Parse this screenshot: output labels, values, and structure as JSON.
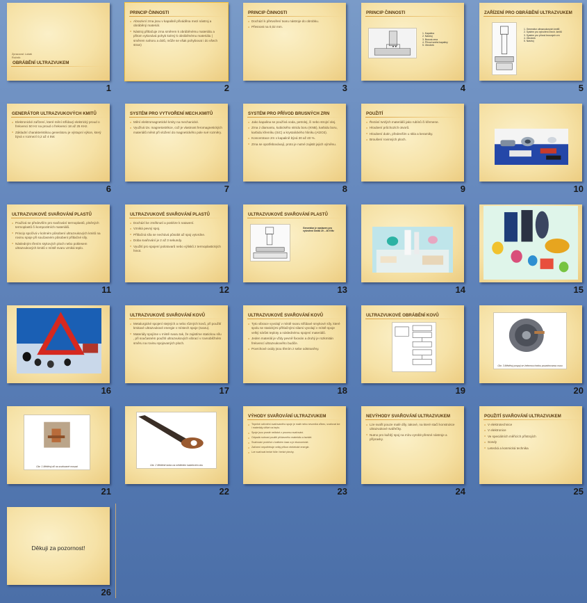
{
  "slides": [
    {
      "num": "1",
      "type": "title",
      "subtitle": [
        "Zpracoval: Lukáš",
        "Ročník:"
      ],
      "title": "OBRÁBĚNÍ ULTRAZVUKEM"
    },
    {
      "num": "2",
      "type": "text",
      "title": "PRINCIP ČINNOSTI",
      "bullets": [
        "Abrazivní zrna jsou v kapalině přiváděna  mezi nástroj a obráběný materiál.",
        "Nástroj přitlačuje zrna směrem k obráběnému materiálu a přitom vykonává pohyb kolmý k obráběnému materiálu  ( směrem nahoru a dolů,  může se však pohybovat i do všech stran)"
      ]
    },
    {
      "num": "3",
      "type": "text",
      "title": "PRINCIP ČINNOSTI",
      "bullets": [
        "Dochází k přetvoření tvaru nástroje do obrobku.",
        "Přesnost na 0,02 mm."
      ]
    },
    {
      "num": "4",
      "type": "diagram",
      "title": "PRINCIP ČINNOSTI",
      "legend": [
        "1. Kapalina",
        "2. Nástroj",
        "3. Brusná zrna",
        "4. Přívod směsi kapaliny",
        "5. Obrobek"
      ]
    },
    {
      "num": "5",
      "type": "diagram2",
      "title": "ZAŘÍZENÍ PRO OBRÁBĚNÍ ULTRAZVUKEM",
      "legend": [
        "1. Generátor ultrazvukových kmitů",
        "2. Systém pro vytvoření mech. kmitů",
        "3. Systém pro přívod brusných zrn",
        "4. Obrobek",
        "5. Nástroj"
      ]
    },
    {
      "num": "6",
      "type": "text",
      "title": "GENERÁTOR ULTRAZVUKOVÝCH KMITŮ",
      "bullets": [
        "Elektronické zařízení, které mění střídavý elektrický proud o frekvenci 50 Hz na proud o frekvenci 18 až 25 KHz.",
        "Základní charakteristikou generátoru je výstupní výkon, který bývá v rozmezí 0,2 až 4 kW."
      ]
    },
    {
      "num": "7",
      "type": "text",
      "title": "SYSTÉM PRO VYTVOŘENÍ MECH.KMITŮ",
      "bullets": [
        "Mění elektromagnetické kmity na mechanické.",
        "Využívá tzv. magnetostrikce, což je vlastnost feromagnetických materiálů měnit při vložení do magnetického pole své rozměry."
      ]
    },
    {
      "num": "8",
      "type": "text",
      "title": "SYSTÉM PRO PŘÍVOD BRUSNÝCH ZRN",
      "bullets": [
        "Jako kapalina se používá voda, petrolej, či nebo strojní olej.",
        "Zrna z diamantu, kubického nitridu boru (KNB), karbidu boru, karbidu křemíku (SiC) a krystalického hliníku  (Al2O3).",
        "Koncentrace zrn v kapalině bývá 30 až 40 %.",
        "Zrna se opotřebovávají, proto je nutné zajistit jejich výměnu."
      ]
    },
    {
      "num": "9",
      "type": "text",
      "title": "POUŽITÍ",
      "bullets": [
        "Řezání tvrdých materiálů jako rubínů či křemene.",
        "Hloubení průchozích otvorů.",
        "Hloubení dutin, především u skla a keramiky.",
        "Broušení rovinných ploch."
      ]
    },
    {
      "num": "10",
      "type": "photo",
      "scene": "parts-blue"
    },
    {
      "num": "11",
      "type": "text",
      "title": "ULTRAZVUKOVÉ SVAŘOVÁNÍ PLASTŮ",
      "bullets": [
        "Použivá se především pro svařování termoplastů, plněných termoplastů či kompozitních materiálů.",
        "Princip spočívá v kolmém působení ultrazvukových kmitů na rovinu spoje při současném působení přítlačné síly.",
        "Následným třením stykových ploch nebo poklesem ultrazvukových kmitů v místě svaru vzniká teplo."
      ]
    },
    {
      "num": "12",
      "type": "text",
      "title": "ULTRAZVUKOVÉ SVAŘOVÁNÍ PLASTŮ",
      "bullets": [
        "Dochází ke změknutí a posléze k natavení.",
        "Vzniká pevný spoj.",
        "Přítlačná síla se nechává působit až spoj vytvrdne.",
        "Doba svařování je 2 až 3 sekundy.",
        "Využití pro spojení polotovarů nebo výlisků z termoplastických hmot."
      ]
    },
    {
      "num": "13",
      "type": "diagram3",
      "title": "ULTRAZVUKOVÉ SVAŘOVÁNÍ PLASTŮ",
      "note": "Generátor je nastaven pro vytvoření kmitů 20 – 40 KHz"
    },
    {
      "num": "14",
      "type": "photo",
      "scene": "lab-white"
    },
    {
      "num": "15",
      "type": "photo",
      "scene": "colorful-plastics"
    },
    {
      "num": "16",
      "type": "photo",
      "scene": "triangle"
    },
    {
      "num": "17",
      "type": "text",
      "title": "ULTRAZVUKOVÉ SVAŘOVÁNÍ KOVŮ",
      "bullets": [
        "Metalurgické spojení stejných a nebo různých kovů, při použití kmitavé ultrazvukové energie v místech spoje (svaru).",
        "Materiály spojíme v místě svaru tak, že zajistíme statickou sílu , při současném použití ultrazvukových vibrací v rovnoběžném směru na rovinu spojovaných  ploch."
      ]
    },
    {
      "num": "18",
      "type": "text",
      "title": "ULTRAZVUKOVÉ SVAŘOVÁNÍ KOVŮ",
      "bullets": [
        "Tyto vibrace vyvolají  v místě svaru střídavé smykové síly, které spolu se statickými přítlačnými silami vyvolají  v místě spoje velký nárůst teploty a následnému  spojení materiálů.",
        "Jeden materiál je vždy pevně fixován a druhý je rozkmitán frekvencí ultrazvukového budiče.",
        "Povrchové oxidy jsou třením  z sebe odstraněny."
      ]
    },
    {
      "num": "19",
      "type": "flow",
      "title": "ULTRAZVUKOVÉ OBRÁBĚNÍ KOVŮ"
    },
    {
      "num": "20",
      "type": "photo-caption",
      "scene": "disc",
      "caption": "Obr. 3 Měděný pospoj se železnou tvrdou pouzdrovanou osou"
    },
    {
      "num": "21",
      "type": "photo-caption",
      "scene": "copper",
      "caption": "Obr. 1 Měděný díl na svařované mosazi"
    },
    {
      "num": "22",
      "type": "photo-caption",
      "scene": "cable",
      "caption": "Obr. 2 Měděné lanko na měděném kabelovém oku"
    },
    {
      "num": "23",
      "type": "text-small",
      "title": "VÝHODY SVAŘOVÁNÍ ULTRAZVUKEM",
      "bullets": [
        "Tepelné ovlivnění svařovaného spoje je malé nebo nevzniká vůbec, svařovat lze i materiály citlivé na teplo.",
        "Spoje jsou prosté nečistot z procesu svařování.",
        "Odpadá nutnost použití přídavného materiálu a tavidel.",
        "Svařování probíhá v krátkém čase a je ekonomické.",
        "Zařízení nepotřebuje velký příkon elektrické energie.",
        "Lze svařovat tenké fólie i tenké plechy."
      ]
    },
    {
      "num": "24",
      "type": "text",
      "title": "NEVÝHODY SVAŘOVÁNÍ ULTRAZVUKEM",
      "bullets": [
        "Lze svařit pouze malé díly, takové, na které stačí konstrukce ultrazvukové svářečky.",
        "Nutno pro každý spoj na  míru vyrobit přesné nástroje a přípravky."
      ]
    },
    {
      "num": "25",
      "type": "text",
      "title": "POUŽITÍ SVAŘOVÁNÍ ULTRAZVUKEM",
      "bullets": [
        "V elektrotechnice",
        "V elektronice",
        "Ve speciálních měřicích přístrojích",
        "Sondy",
        "Letecká a kosmická technika"
      ]
    },
    {
      "num": "26",
      "type": "thanks",
      "text": "Děkuji za pozornost!"
    }
  ]
}
